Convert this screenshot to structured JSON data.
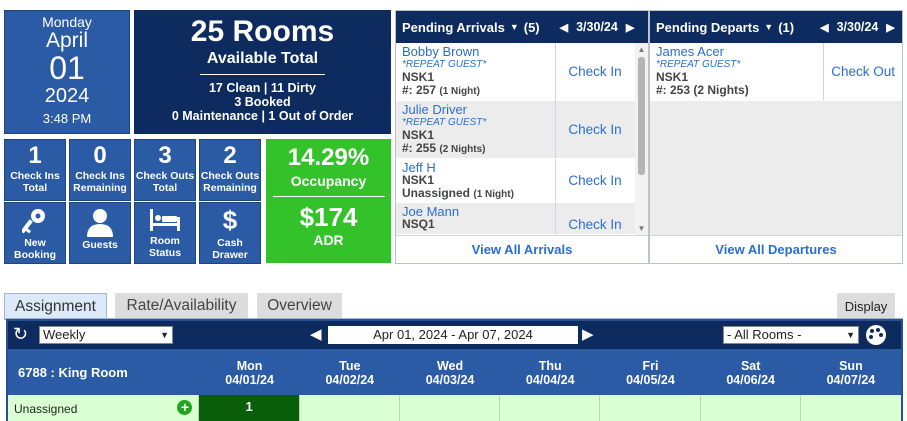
{
  "date_tile": {
    "weekday": "Monday",
    "month": "April",
    "day": "01",
    "year": "2024",
    "time": "3:48 PM"
  },
  "rooms_tile": {
    "headline": "25 Rooms",
    "subhead": "Available Total",
    "line1": "17 Clean | 11 Dirty",
    "line2": "3 Booked",
    "line3": "0 Maintenance | 1 Out of Order"
  },
  "stats": [
    {
      "value": "1",
      "label": "Check Ins Total"
    },
    {
      "value": "0",
      "label": "Check Ins Remaining"
    },
    {
      "value": "3",
      "label": "Check Outs Total"
    },
    {
      "value": "2",
      "label": "Check Outs Remaining"
    }
  ],
  "actions": [
    {
      "icon": "key-icon",
      "label": "New Booking"
    },
    {
      "icon": "person-icon",
      "label": "Guests"
    },
    {
      "icon": "bed-icon",
      "label": "Room Status"
    },
    {
      "icon": "dollar-icon",
      "label": "Cash Drawer"
    }
  ],
  "occupancy": {
    "value": "14.29%",
    "label": "Occupancy",
    "adr_value": "$174",
    "adr_label": "ADR"
  },
  "arrivals": {
    "title": "Pending Arrivals",
    "count": "(5)",
    "date": "3/30/24",
    "view_all": "View All Arrivals",
    "guests": [
      {
        "name": "Bobby Brown",
        "repeat": "*REPEAT GUEST*",
        "code": "NSK1",
        "room": "#: 257",
        "nights": "(1 Night)",
        "action": "Check In"
      },
      {
        "name": "Julie Driver",
        "repeat": "*REPEAT GUEST*",
        "code": "NSK1",
        "room": "#: 255",
        "nights": "(2 Nights)",
        "action": "Check In"
      },
      {
        "name": "Jeff H",
        "repeat": "",
        "code": "NSK1",
        "room": "Unassigned",
        "nights": "(1 Night)",
        "action": "Check In"
      },
      {
        "name": "Joe Mann",
        "repeat": "",
        "code": "NSQ1",
        "room": "",
        "nights": "",
        "action": "Check In"
      }
    ]
  },
  "departures": {
    "title": "Pending Departs",
    "count": "(1)",
    "date": "3/30/24",
    "view_all": "View All Departures",
    "guests": [
      {
        "name": "James Acer",
        "repeat": "*REPEAT GUEST*",
        "code": "NSK1",
        "room": "#: 253",
        "nights": "(2 Nights)",
        "action": "Check Out"
      }
    ]
  },
  "tabs": [
    {
      "label": "Assignment",
      "active": true
    },
    {
      "label": "Rate/Availability",
      "active": false
    },
    {
      "label": "Overview",
      "active": false
    }
  ],
  "display_button": "Display",
  "calendar": {
    "view_select": "Weekly",
    "date_range": "Apr 01, 2024 - Apr 07, 2024",
    "rooms_select": "- All Rooms -",
    "room_type": "6788 : King Room",
    "days": [
      {
        "dow": "Mon",
        "date": "04/01/24"
      },
      {
        "dow": "Tue",
        "date": "04/02/24"
      },
      {
        "dow": "Wed",
        "date": "04/03/24"
      },
      {
        "dow": "Thu",
        "date": "04/04/24"
      },
      {
        "dow": "Fri",
        "date": "04/05/24"
      },
      {
        "dow": "Sat",
        "date": "04/06/24"
      },
      {
        "dow": "Sun",
        "date": "04/07/24"
      }
    ],
    "unassigned_label": "Unassigned",
    "unassigned_counts": [
      "1",
      "",
      "",
      "",
      "",
      "",
      ""
    ]
  },
  "colors": {
    "tile_blue": "#2a5ba4",
    "navy": "#0d2b5e",
    "green": "#34c22b",
    "link_blue": "#2a6fd0",
    "calendar_green": "#d9ffd2",
    "cell_dark_green": "#0a5e0a"
  }
}
